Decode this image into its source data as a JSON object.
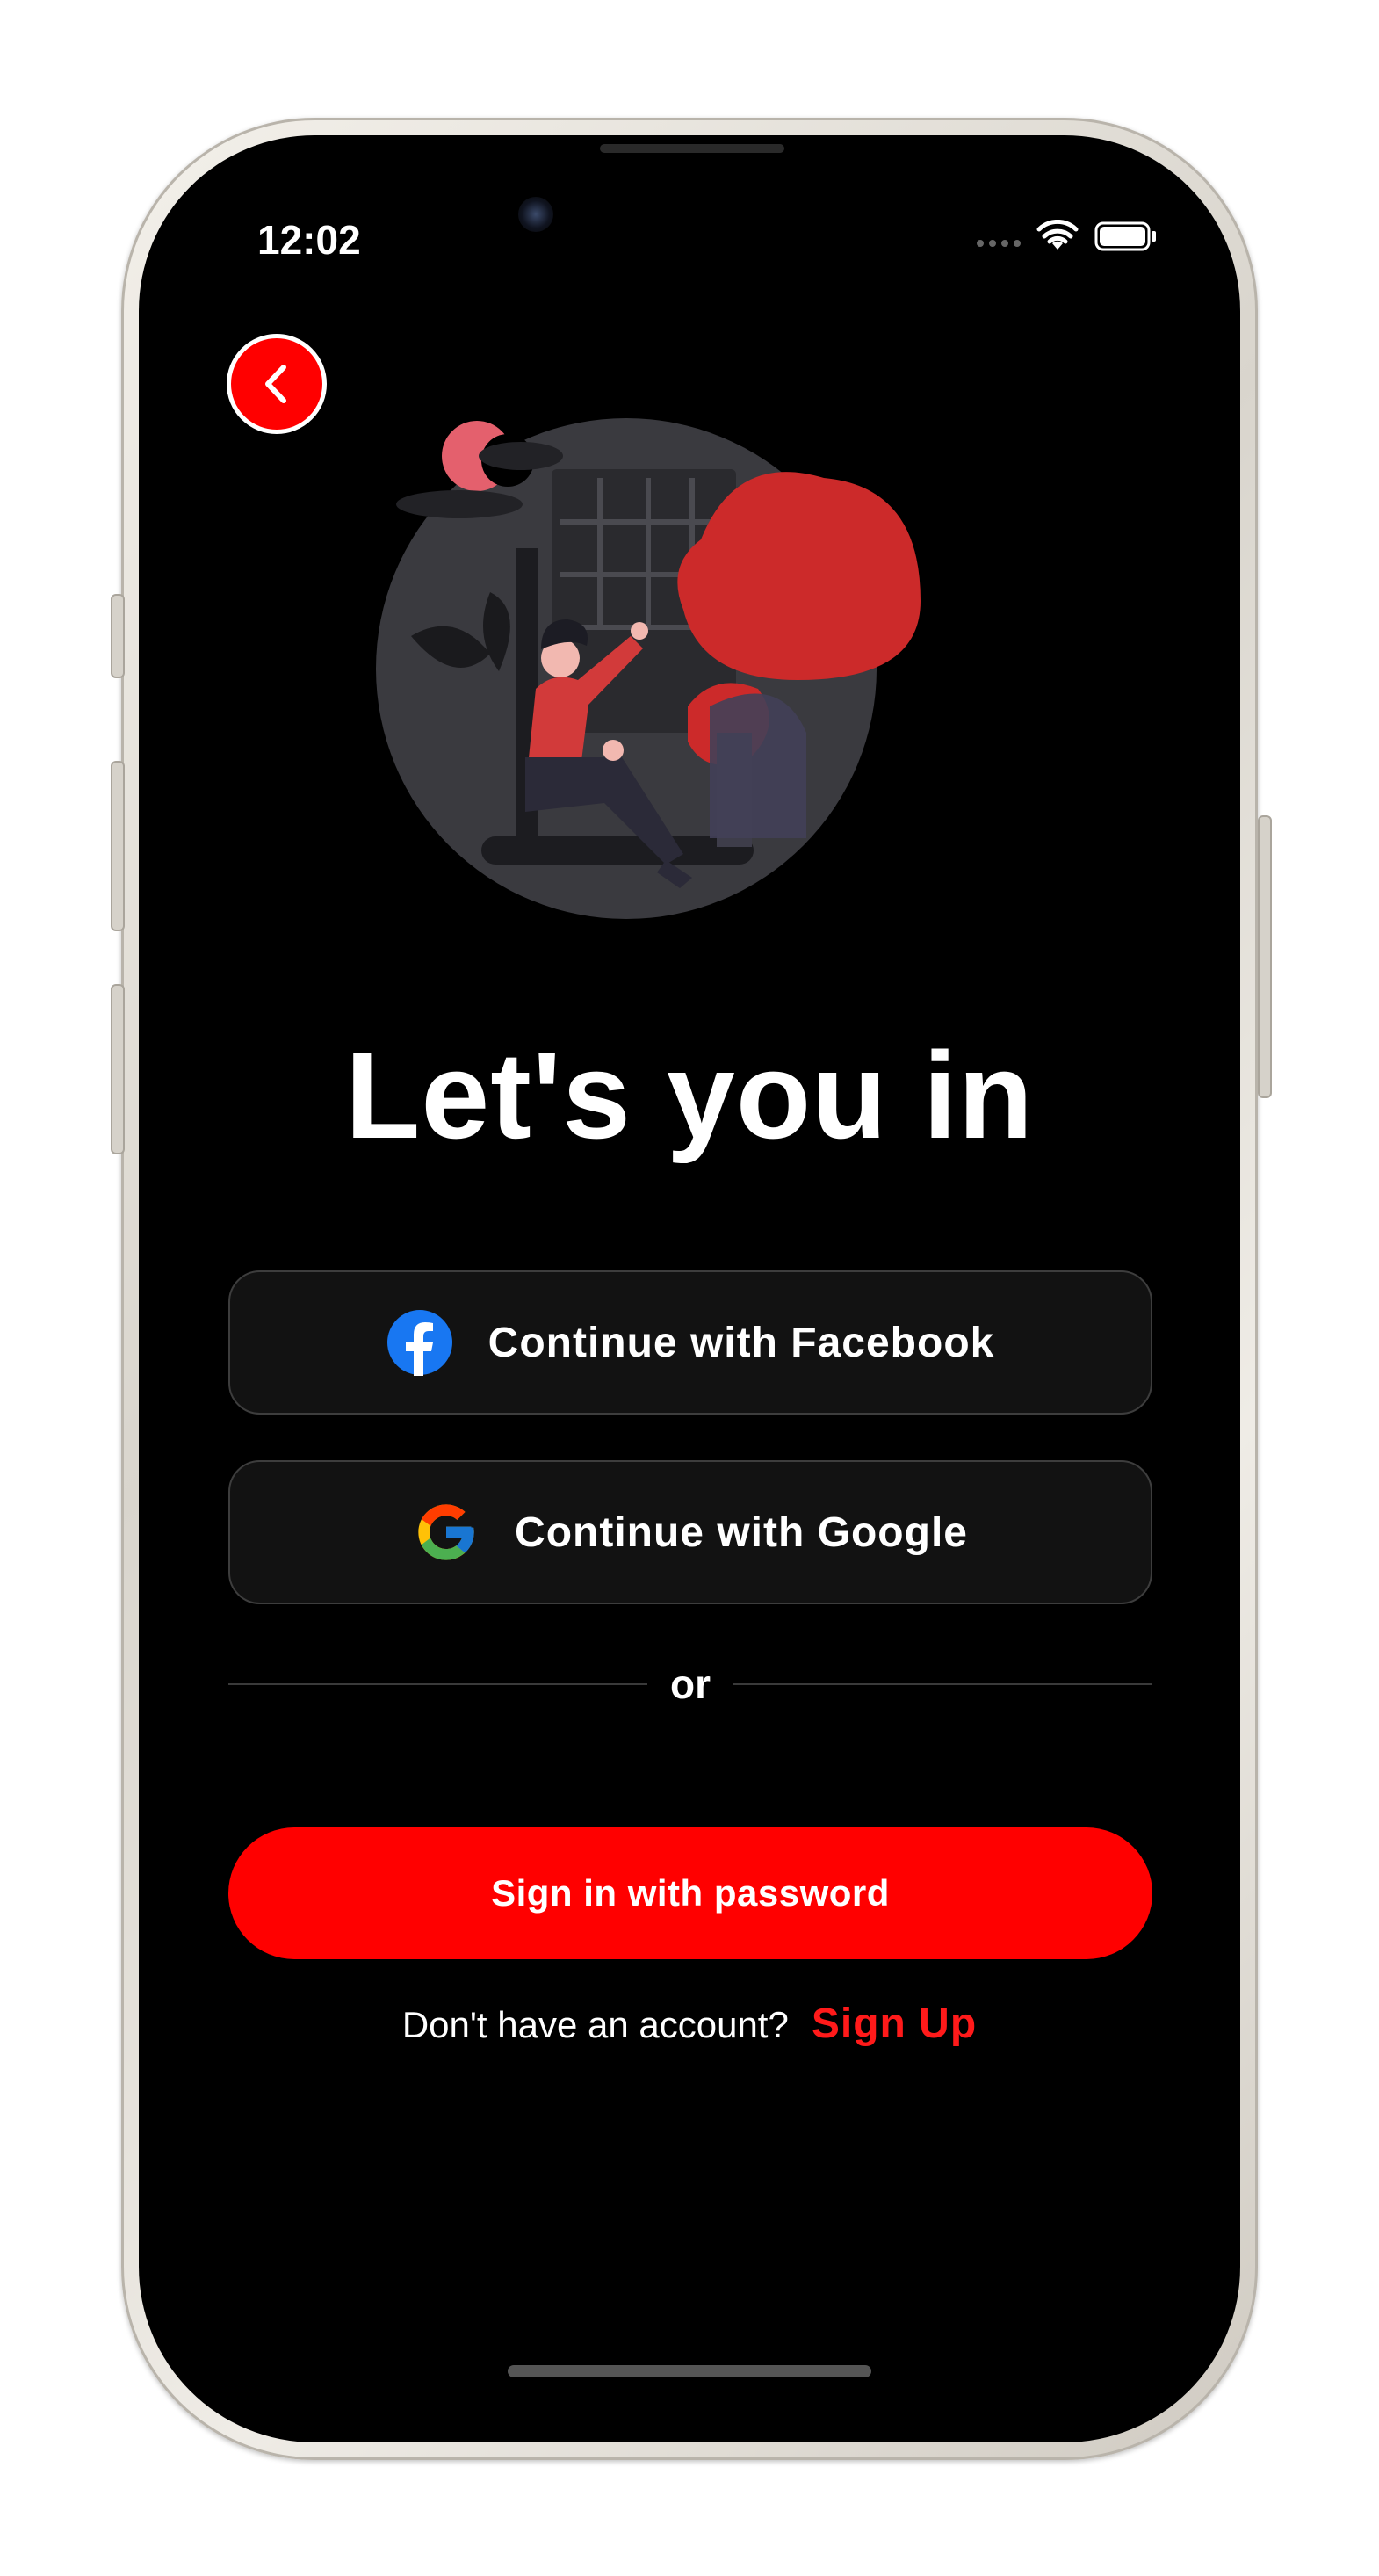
{
  "status_bar": {
    "time": "12:02"
  },
  "nav": {
    "back_icon": "chevron-left-icon"
  },
  "main": {
    "title": "Let's you in",
    "buttons": {
      "facebook_label": "Continue with Facebook",
      "google_label": "Continue with Google",
      "password_label": "Sign in with password"
    },
    "divider_text": "or",
    "signup_prompt": "Don't have an account?",
    "signup_link": "Sign Up"
  },
  "colors": {
    "accent": "#ff0000",
    "background": "#000000",
    "button_surface": "#121212",
    "facebook_blue": "#1877f2"
  },
  "icons": {
    "facebook": "facebook-logo-icon",
    "google": "google-logo-icon",
    "wifi": "wifi-icon",
    "battery": "battery-icon"
  }
}
